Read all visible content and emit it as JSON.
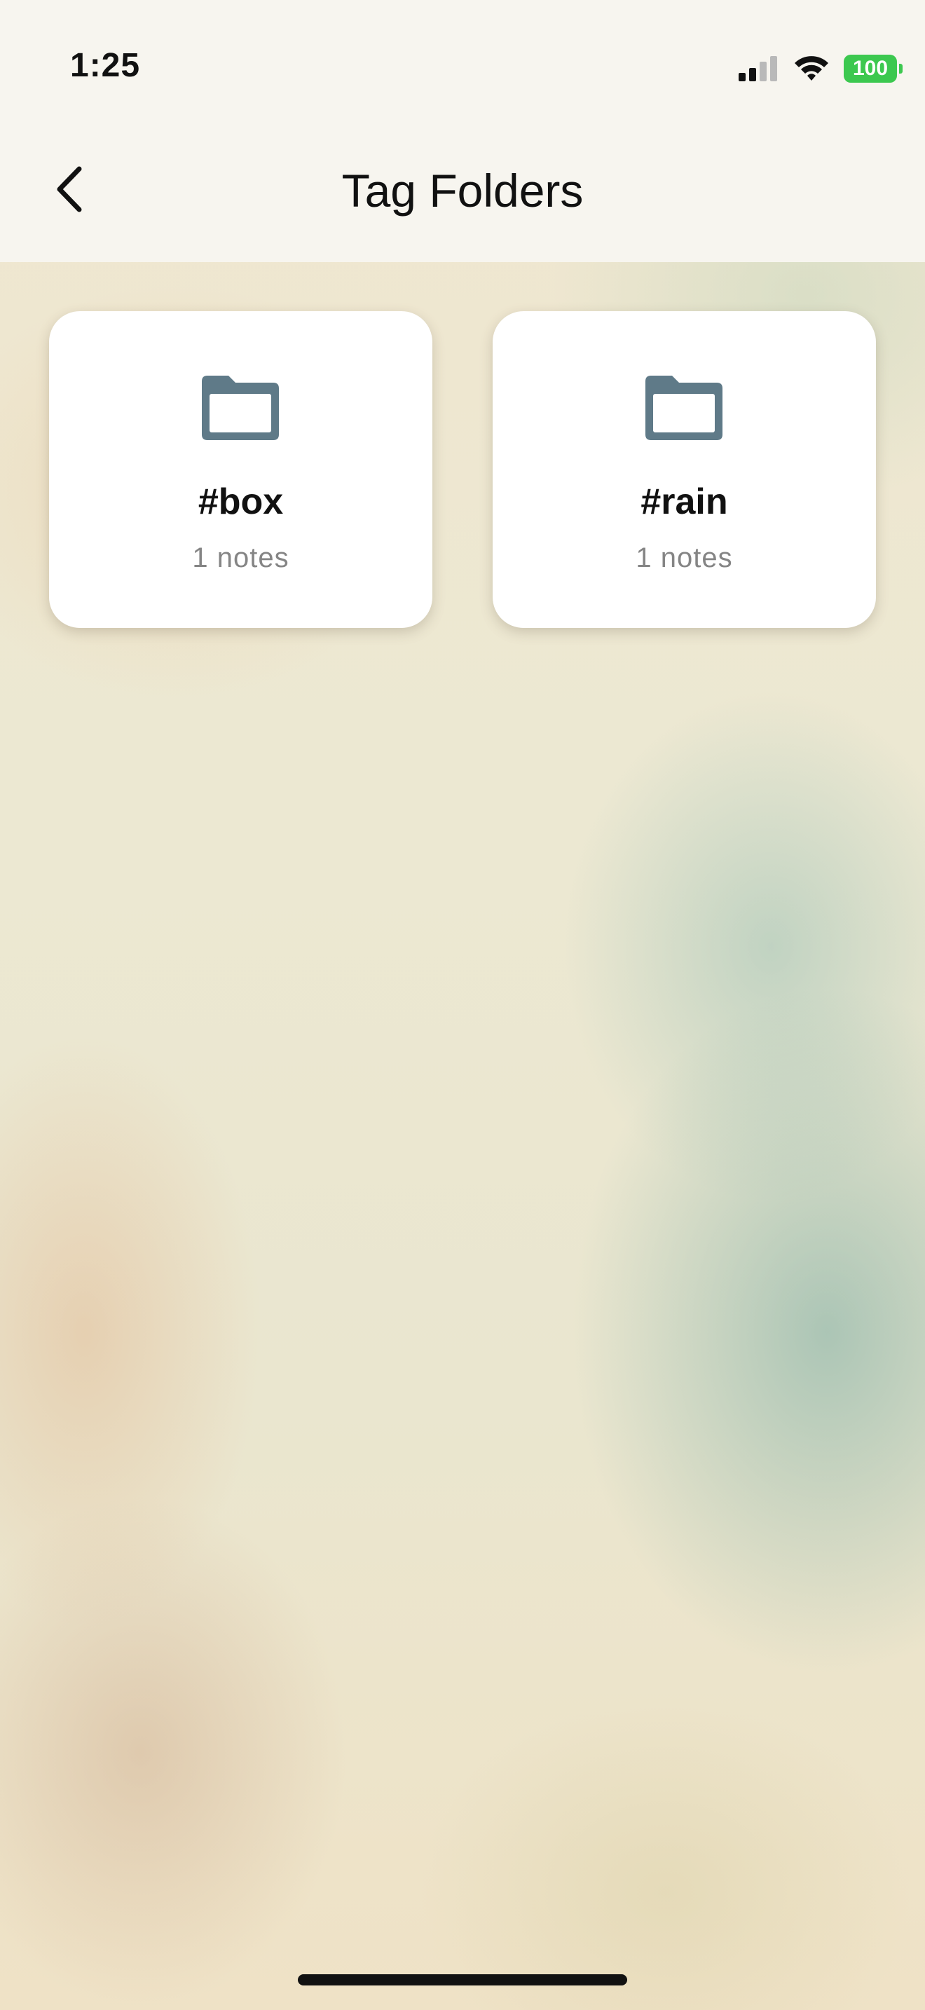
{
  "status_bar": {
    "time": "1:25",
    "battery": "100",
    "battery_color": "#3cc84f"
  },
  "nav": {
    "title": "Tag Folders",
    "back_icon": "chevron-left-icon"
  },
  "folders": [
    {
      "tag": "#box",
      "count": "1 notes",
      "icon": "folder-icon"
    },
    {
      "tag": "#rain",
      "count": "1 notes",
      "icon": "folder-icon"
    }
  ],
  "colors": {
    "folder_icon": "#5f7a88",
    "card_background": "#ffffff",
    "count_text": "#858585"
  }
}
